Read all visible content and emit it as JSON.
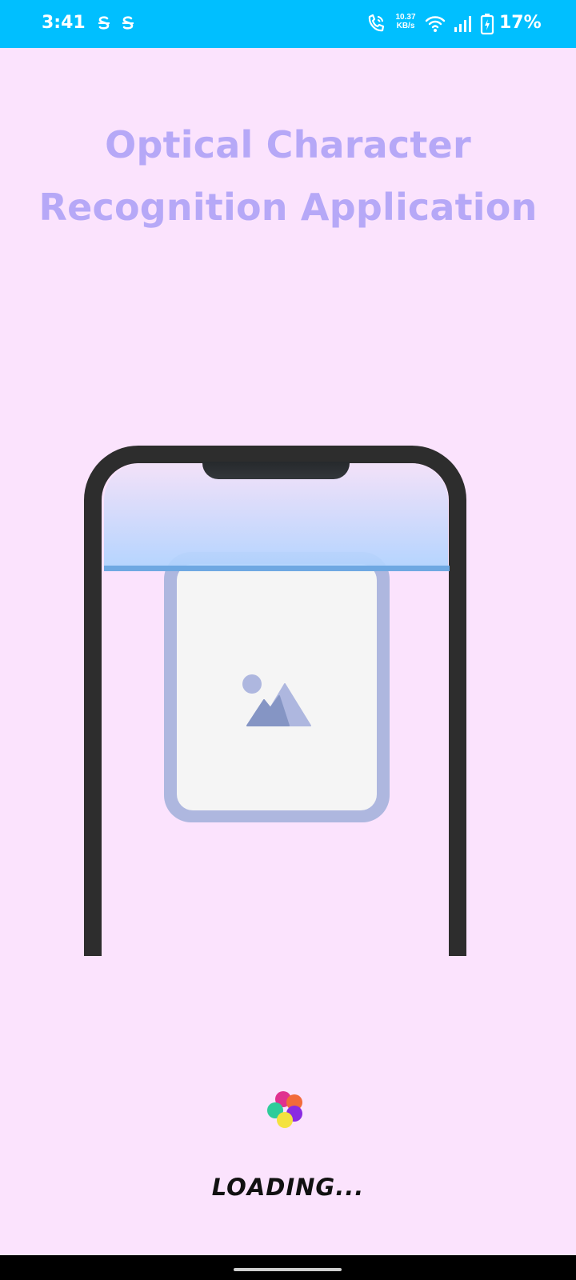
{
  "status_bar": {
    "time": "3:41",
    "net_speed_value": "10.37",
    "net_speed_unit": "KB/s",
    "battery_percent": "17%",
    "icons": [
      "sync-s-icon",
      "sync-s-icon",
      "wifi-call-icon",
      "wifi-icon",
      "signal-icon",
      "battery-charging-icon"
    ],
    "background_color": "#00bfff"
  },
  "header": {
    "title_line1": "Optical Character",
    "title_line2": "Recognition Application",
    "title_color": "#b6a8f7"
  },
  "illustration": {
    "phone_frame_color": "#2d2d2d",
    "scanner_color": "#b0d4ff",
    "card_border_color": "#aeb7df",
    "image_icon": "image-placeholder-icon"
  },
  "loader": {
    "dot_colors": [
      "#e0318f",
      "#f26b3a",
      "#2ecc9a",
      "#8a2be2",
      "#f4e240"
    ]
  },
  "footer": {
    "loading_label": "LOADING..."
  },
  "background_color": "#fbe3fd"
}
